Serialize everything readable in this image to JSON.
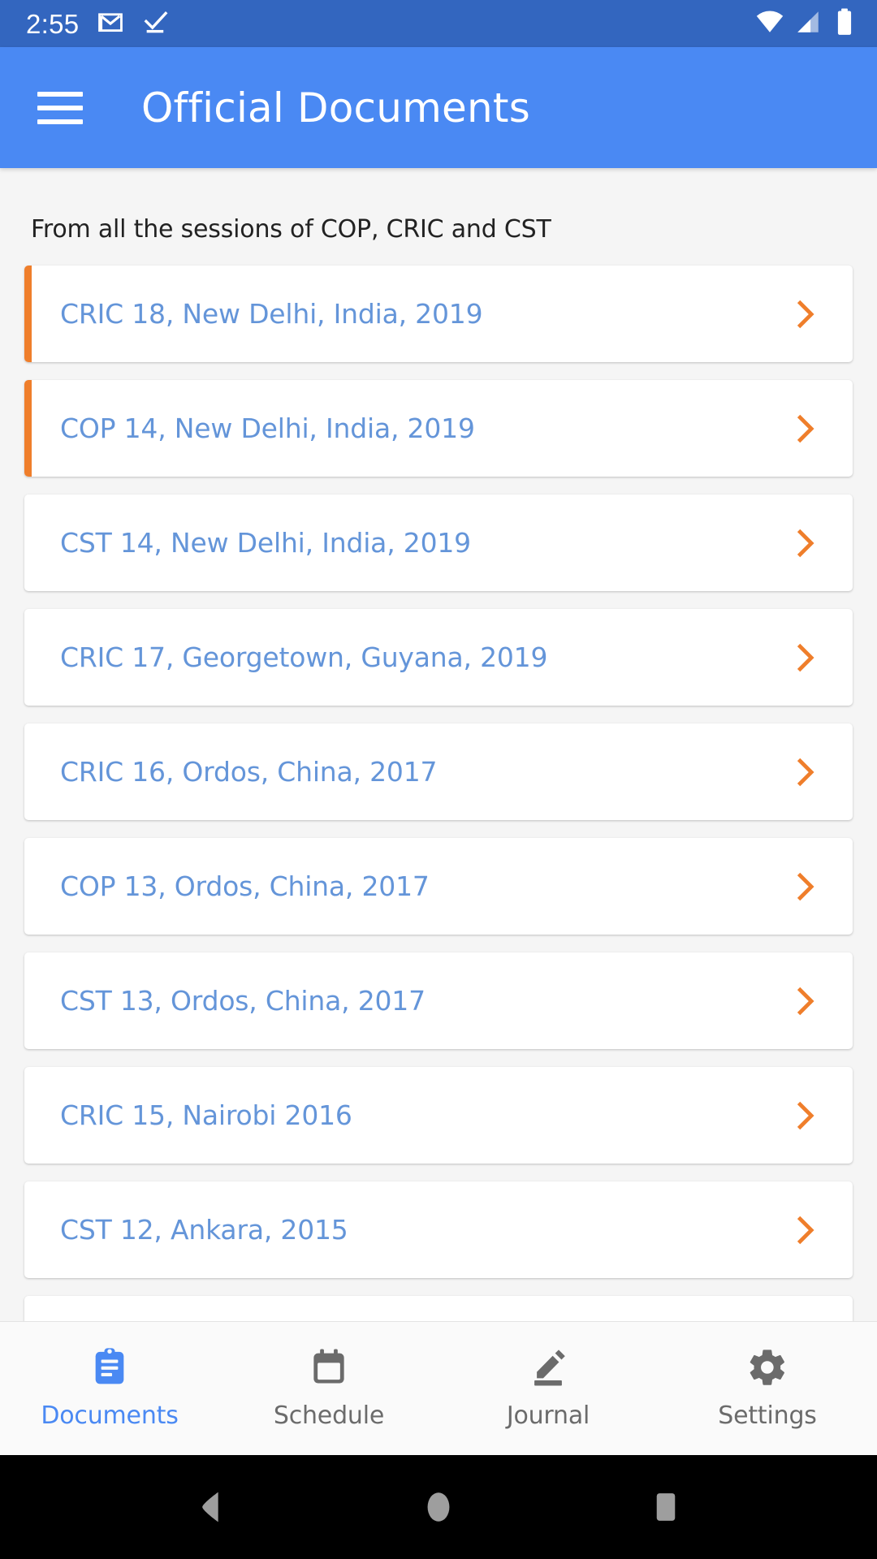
{
  "status_bar": {
    "clock": "2:55",
    "left_icons": [
      "gmail-icon",
      "checkmark-icon"
    ],
    "right_icons": [
      "wifi-icon",
      "cell-signal-icon",
      "battery-icon"
    ],
    "background_color": "#3366BF"
  },
  "app_bar": {
    "menu_icon": "hamburger-menu-icon",
    "title": "Official Documents",
    "background_color": "#4A89F3"
  },
  "main": {
    "subtitle": "From all the sessions of COP, CRIC and CST",
    "accent_color": "#EF7E2B",
    "link_color": "#6495D9",
    "items": [
      {
        "label": "CRIC 18, New Delhi, India, 2019",
        "accent": true
      },
      {
        "label": "COP 14, New Delhi, India, 2019",
        "accent": true
      },
      {
        "label": "CST 14, New Delhi, India, 2019",
        "accent": false
      },
      {
        "label": "CRIC 17, Georgetown, Guyana, 2019",
        "accent": false
      },
      {
        "label": "CRIC 16, Ordos, China, 2017",
        "accent": false
      },
      {
        "label": "COP 13, Ordos, China, 2017",
        "accent": false
      },
      {
        "label": "CST 13, Ordos, China, 2017",
        "accent": false
      },
      {
        "label": "CRIC 15, Nairobi 2016",
        "accent": false
      },
      {
        "label": "CST 12, Ankara, 2015",
        "accent": false
      },
      {
        "label": "",
        "accent": false
      }
    ]
  },
  "bottom_nav": {
    "active_color": "#4A89F3",
    "inactive_color": "#6B6B6B",
    "items": [
      {
        "label": "Documents",
        "icon": "clipboard-icon",
        "active": true
      },
      {
        "label": "Schedule",
        "icon": "calendar-icon",
        "active": false
      },
      {
        "label": "Journal",
        "icon": "edit-pencil-icon",
        "active": false
      },
      {
        "label": "Settings",
        "icon": "gear-icon",
        "active": false
      }
    ]
  },
  "android_nav": {
    "buttons": [
      {
        "name": "back-button",
        "icon": "triangle-left-icon"
      },
      {
        "name": "home-button",
        "icon": "circle-icon"
      },
      {
        "name": "recents-button",
        "icon": "square-icon"
      }
    ]
  }
}
